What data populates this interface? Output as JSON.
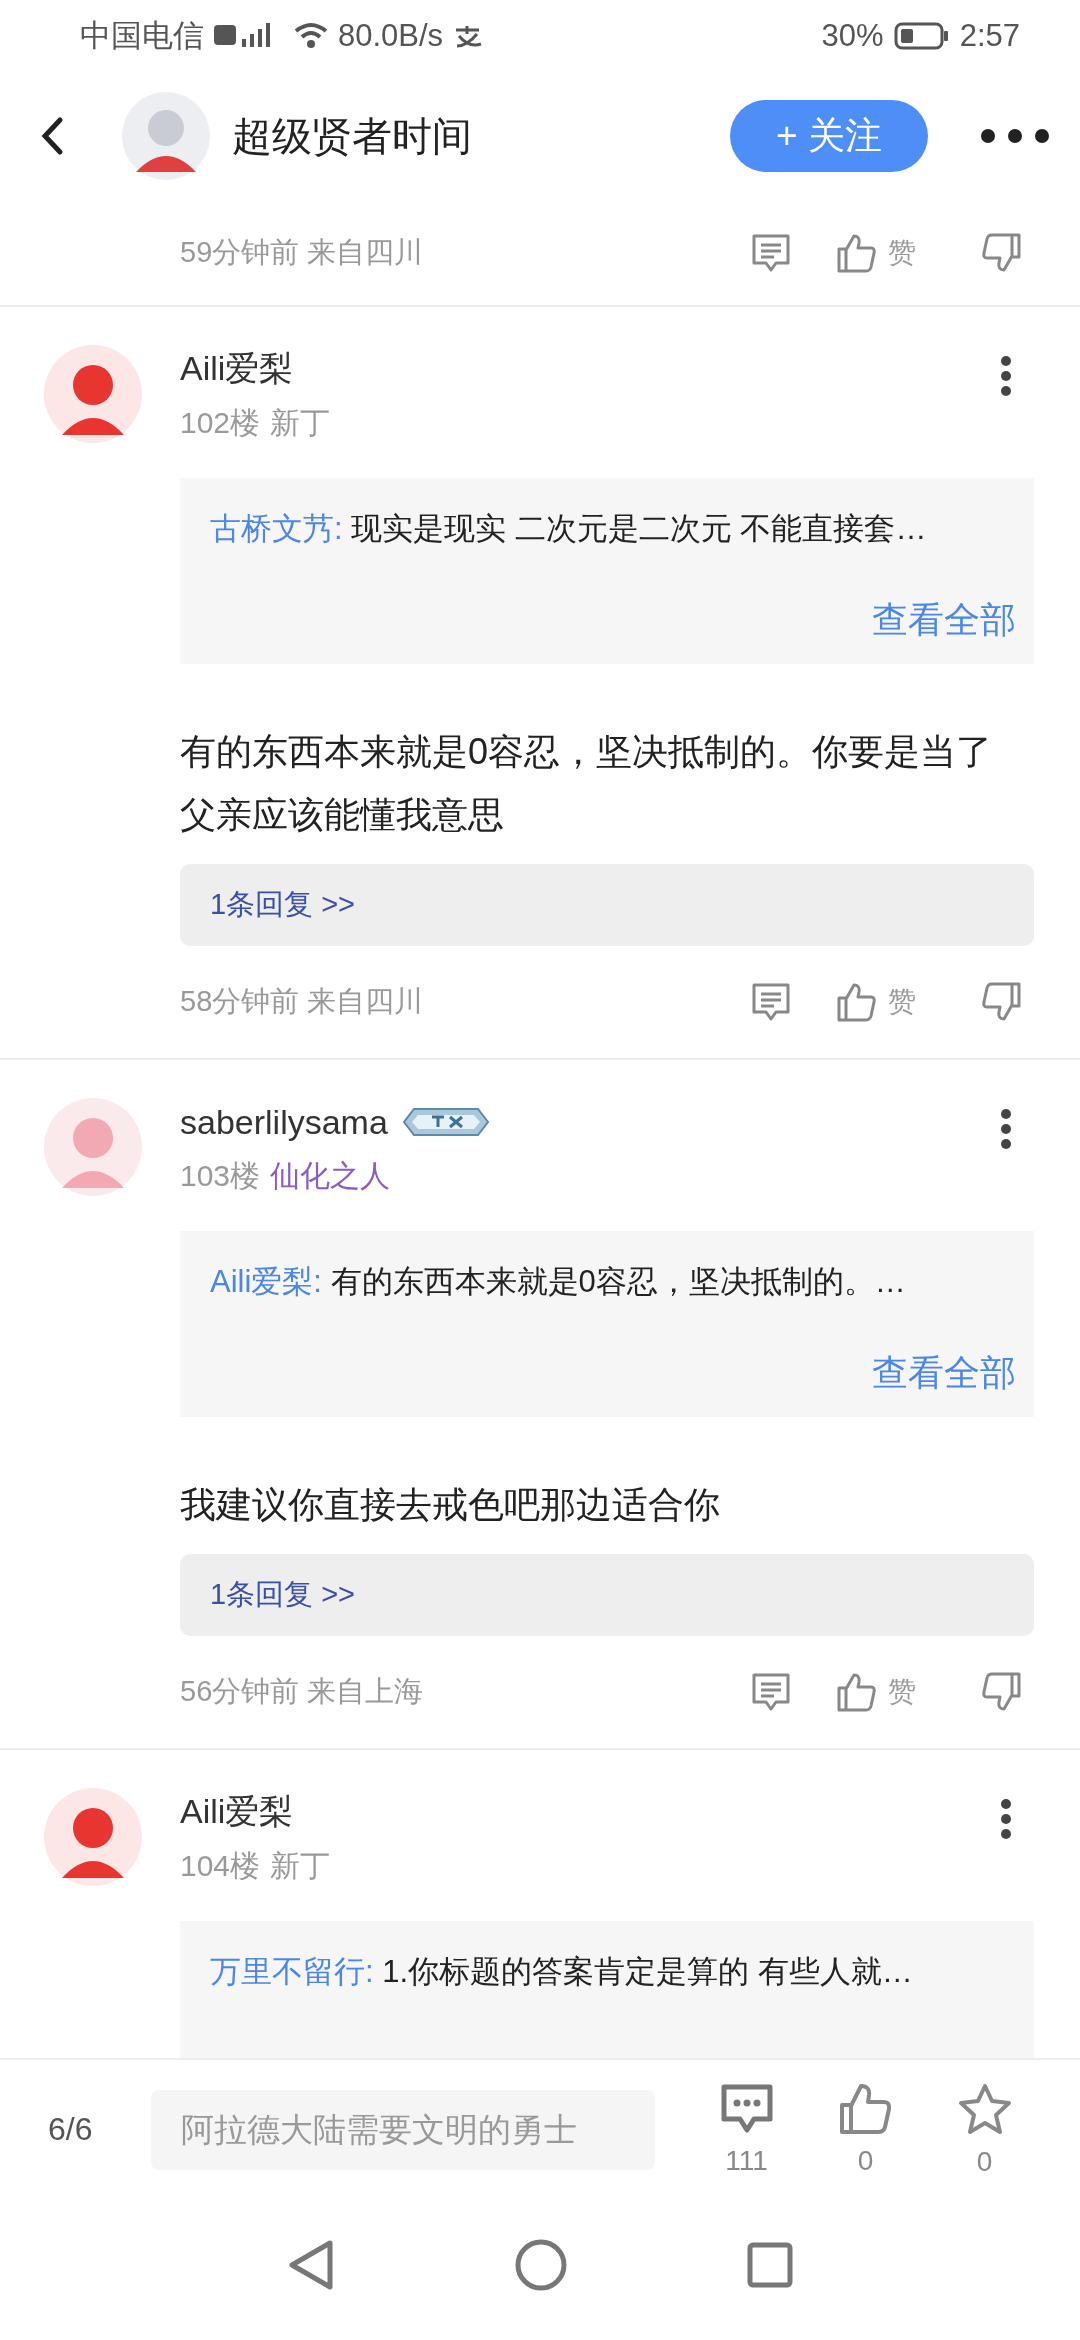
{
  "status_bar": {
    "carrier": "中国电信",
    "network_speed": "80.0B/s",
    "battery_percent": "30%",
    "time": "2:57"
  },
  "header": {
    "title": "超级贤者时间",
    "follow_button": "+ 关注"
  },
  "top_meta": {
    "time_location": "59分钟前 来自四川",
    "like_label": "赞"
  },
  "comments": [
    {
      "name": "Aili爱梨",
      "has_badge": false,
      "floor": "102楼",
      "rank": {
        "text": "新丁",
        "color": "#999999"
      },
      "quote": {
        "author": "古桥文艿:",
        "text": "现实是现实 二次元是二次元 不能直接套…",
        "more": "查看全部"
      },
      "body": "有的东西本来就是0容忍，坚决抵制的。你要是当了父亲应该能懂我意思",
      "reply_link": "1条回复 >>",
      "time_location": "58分钟前 来自四川",
      "like_label": "赞"
    },
    {
      "name": "saberlilysama",
      "has_badge": true,
      "floor": "103楼",
      "rank": {
        "text": "仙化之人",
        "color": "#8a5cc4"
      },
      "quote": {
        "author": "Aili爱梨:",
        "text": "有的东西本来就是0容忍，坚决抵制的。…",
        "more": "查看全部"
      },
      "body": "我建议你直接去戒色吧那边适合你",
      "reply_link": "1条回复 >>",
      "time_location": "56分钟前 来自上海",
      "like_label": "赞"
    },
    {
      "name": "Aili爱梨",
      "has_badge": false,
      "floor": "104楼",
      "rank": {
        "text": "新丁",
        "color": "#999999"
      },
      "quote": {
        "author": "万里不留行:",
        "text": "1.你标题的答案肯定是算的 有些人就…"
      }
    }
  ],
  "bottom_bar": {
    "page": "6/6",
    "placeholder": "阿拉德大陆需要文明的勇士",
    "comment_count": "111",
    "like_count": "0",
    "star_count": "0"
  }
}
